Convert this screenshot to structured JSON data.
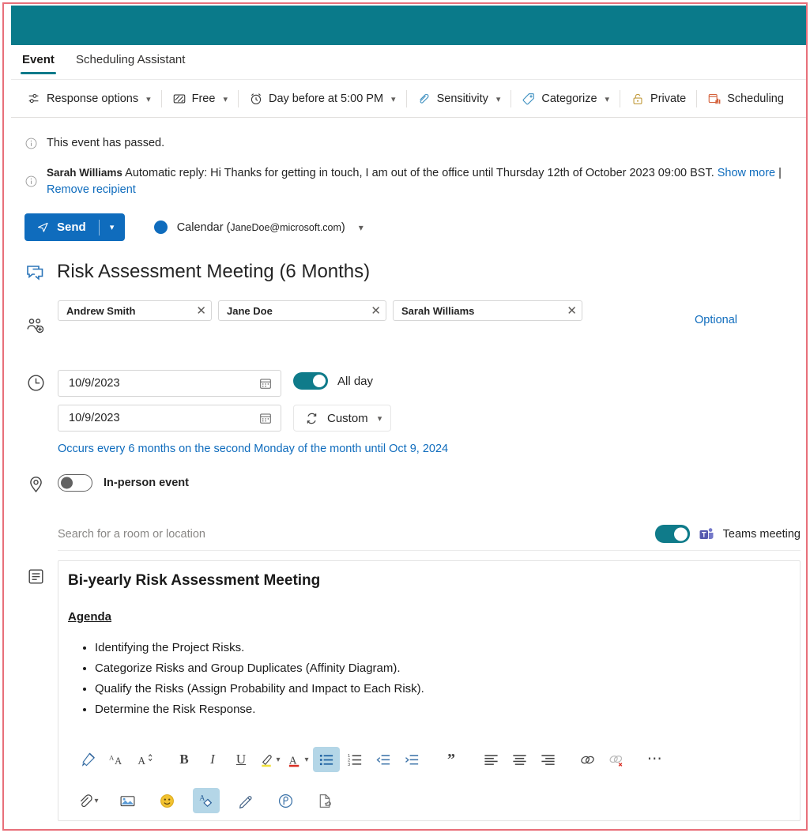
{
  "window": {
    "title_bar_color": "#0a7a8a",
    "border_color": "#e8707a",
    "accent_blue": "#0f6cbd",
    "teal": "#0f7b8a"
  },
  "tabs": [
    {
      "label": "Event",
      "active": true
    },
    {
      "label": "Scheduling Assistant",
      "active": false
    }
  ],
  "commandbar": [
    {
      "label": "Response options",
      "icon": "response-options-icon",
      "caret": true
    },
    {
      "label": "Free",
      "icon": "busy-status-icon",
      "caret": true
    },
    {
      "label": "Day before at 5:00 PM",
      "icon": "alarm-clock-icon",
      "caret": true
    },
    {
      "label": "Sensitivity",
      "icon": "sensitivity-icon",
      "caret": true
    },
    {
      "label": "Categorize",
      "icon": "tag-icon",
      "caret": true
    },
    {
      "label": "Private",
      "icon": "lock-icon",
      "caret": false
    },
    {
      "label": "Scheduling",
      "icon": "scheduling-poll-icon",
      "caret": false
    }
  ],
  "notices": {
    "passed": "This event has passed.",
    "reply_sender": "Sarah Williams",
    "reply_text": "Automatic reply: Hi Thanks for getting in touch, I am out of the office until Thursday 12th of October 2023 09:00 BST.",
    "show_more": "Show more",
    "separator": "|",
    "remove_recipient": "Remove recipient"
  },
  "send": {
    "label": "Send",
    "calendar_text": "Calendar (",
    "calendar_email": "JaneDoe@microsoft.com",
    "calendar_text_end": ")"
  },
  "event": {
    "title": "Risk Assessment Meeting (6 Months)",
    "optional_label": "Optional",
    "attendees": [
      {
        "name": "Andrew Smith"
      },
      {
        "name": "Jane Doe"
      },
      {
        "name": "Sarah Williams"
      }
    ],
    "start_date": "10/9/2023",
    "end_date": "10/9/2023",
    "all_day_label": "All day",
    "all_day_on": true,
    "recurrence_button": "Custom",
    "recurrence_text": "Occurs every 6 months on the second Monday of the month until Oct 9, 2024",
    "in_person_label": "In-person event",
    "in_person_on": false,
    "location_placeholder": "Search for a room or location",
    "teams_label": "Teams meeting",
    "teams_on": true
  },
  "body": {
    "heading": "Bi-yearly Risk Assessment Meeting",
    "agenda_label": "Agenda",
    "agenda_items": [
      "Identifying the Project Risks.",
      "Categorize Risks and Group Duplicates (Affinity Diagram).",
      "Qualify the Risks (Assign Probability and Impact to Each Risk).",
      "Determine the Risk Response."
    ]
  },
  "format_toolbar_row1": [
    {
      "icon": "format-painter-icon",
      "active": false
    },
    {
      "icon": "font-family-icon",
      "active": false
    },
    {
      "icon": "font-size-icon",
      "active": false
    },
    {
      "icon": "bold-icon",
      "active": false
    },
    {
      "icon": "italic-icon",
      "active": false
    },
    {
      "icon": "underline-icon",
      "active": false
    },
    {
      "icon": "highlight-color-icon",
      "active": false
    },
    {
      "icon": "font-color-icon",
      "active": false
    },
    {
      "icon": "bulleted-list-icon",
      "active": true
    },
    {
      "icon": "numbered-list-icon",
      "active": false
    },
    {
      "icon": "decrease-indent-icon",
      "active": false
    },
    {
      "icon": "increase-indent-icon",
      "active": false
    },
    {
      "icon": "quote-icon",
      "active": false
    },
    {
      "icon": "align-left-icon",
      "active": false
    },
    {
      "icon": "align-center-icon",
      "active": false
    },
    {
      "icon": "align-right-icon",
      "active": false
    },
    {
      "icon": "insert-link-icon",
      "active": false
    },
    {
      "icon": "remove-link-icon",
      "active": false
    },
    {
      "icon": "more-options-icon",
      "active": false
    }
  ],
  "format_toolbar_row2": [
    {
      "icon": "attach-file-icon",
      "active": false
    },
    {
      "icon": "insert-picture-icon",
      "active": false
    },
    {
      "icon": "emoji-icon",
      "active": false
    },
    {
      "icon": "formatting-options-icon",
      "active": true
    },
    {
      "icon": "signature-icon",
      "active": false
    },
    {
      "icon": "loop-component-icon",
      "active": false
    },
    {
      "icon": "insert-from-onedrive-icon",
      "active": false
    }
  ],
  "rail_icons": [
    {
      "icon": "teams-chat-icon"
    },
    {
      "icon": "add-people-icon"
    },
    {
      "icon": "clock-icon"
    },
    {
      "icon": "location-pin-icon"
    },
    {
      "icon": "description-icon"
    }
  ]
}
